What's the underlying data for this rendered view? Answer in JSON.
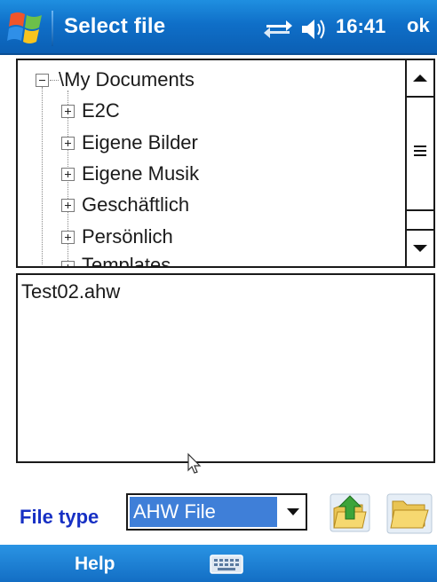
{
  "titlebar": {
    "title": "Select file",
    "time": "16:41",
    "ok_label": "ok",
    "icons": [
      "windows-start-icon",
      "connectivity-icon",
      "volume-icon"
    ]
  },
  "tree": {
    "root": "\\My Documents",
    "items": [
      {
        "label": "E2C"
      },
      {
        "label": "Eigene Bilder"
      },
      {
        "label": "Eigene Musik"
      },
      {
        "label": "Geschäftlich"
      },
      {
        "label": "Persönlich"
      },
      {
        "label": "Templates"
      }
    ]
  },
  "files": [
    "Test02.ahw"
  ],
  "file_type": {
    "label": "File type",
    "selected": "AHW File"
  },
  "menubar": {
    "help_label": "Help"
  },
  "colors": {
    "titlebar_blue": "#0f6fc8",
    "label_blue": "#1730c4",
    "selection_blue": "#3f7fd8"
  }
}
